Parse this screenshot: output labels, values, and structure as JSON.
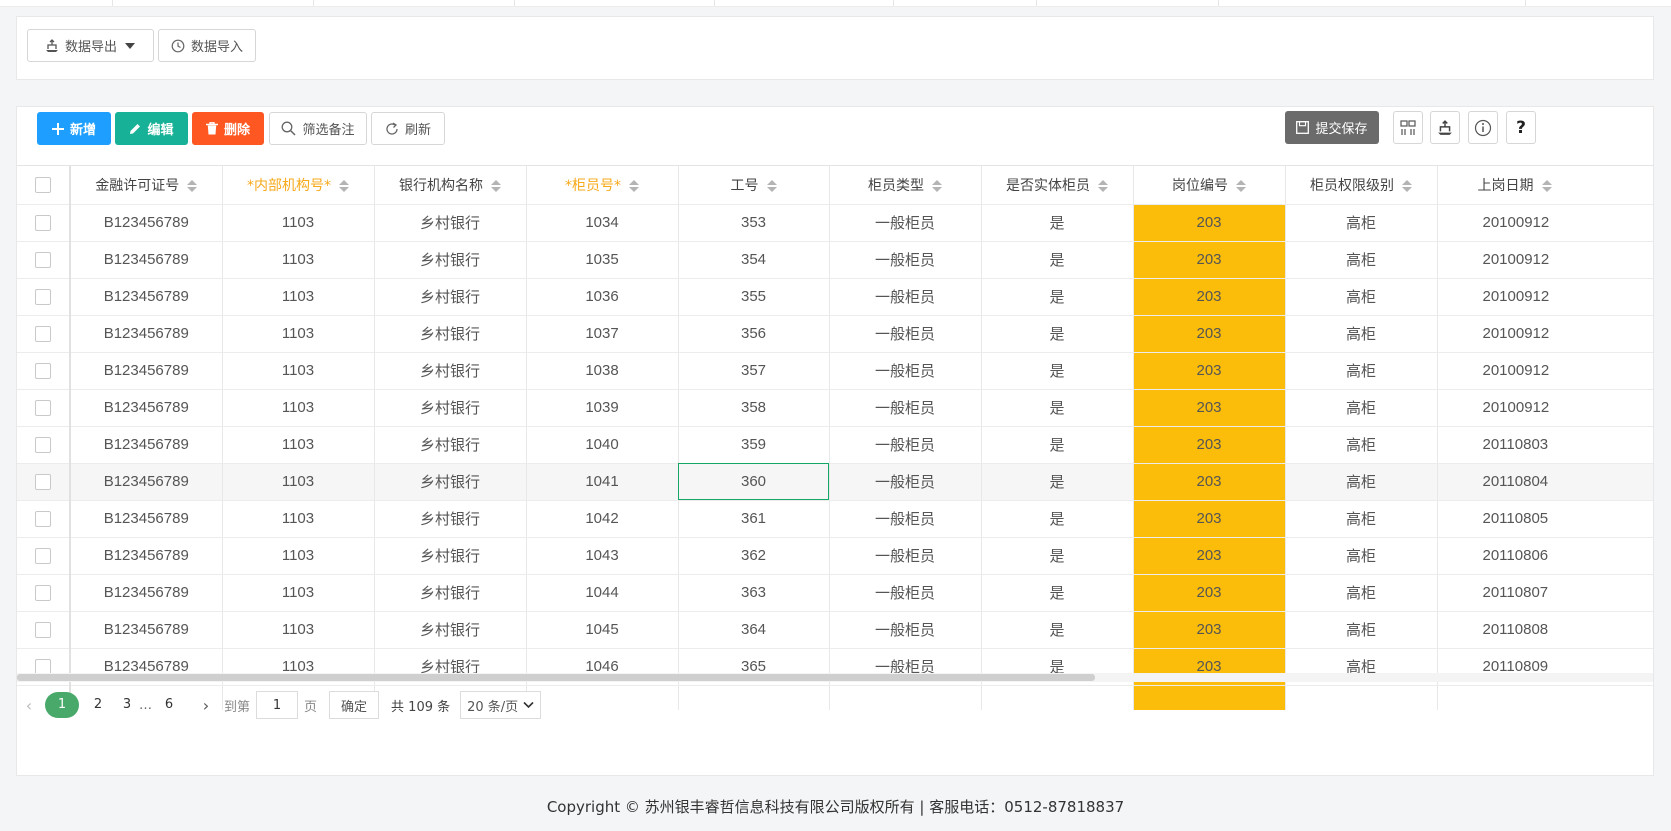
{
  "export_panel": {
    "export_label": "数据导出",
    "import_label": "数据导入"
  },
  "toolbar": {
    "add_label": "新增",
    "edit_label": "编辑",
    "delete_label": "删除",
    "filter_label": "筛选备注",
    "refresh_label": "刷新",
    "submit_label": "提交保存",
    "help_label": "?"
  },
  "table": {
    "columns": [
      {
        "label": "金融许可证号",
        "required": false
      },
      {
        "label": "*内部机构号*",
        "required": true
      },
      {
        "label": "银行机构名称",
        "required": false
      },
      {
        "label": "*柜员号*",
        "required": true
      },
      {
        "label": "工号",
        "required": false
      },
      {
        "label": "柜员类型",
        "required": false
      },
      {
        "label": "是否实体柜员",
        "required": false
      },
      {
        "label": "岗位编号",
        "required": false
      },
      {
        "label": "柜员权限级别",
        "required": false
      },
      {
        "label": "上岗日期",
        "required": false
      }
    ],
    "rows": [
      [
        "B123456789",
        "1103",
        "乡村银行",
        "1034",
        "353",
        "一般柜员",
        "是",
        "203",
        "高柜",
        "20100912"
      ],
      [
        "B123456789",
        "1103",
        "乡村银行",
        "1035",
        "354",
        "一般柜员",
        "是",
        "203",
        "高柜",
        "20100912"
      ],
      [
        "B123456789",
        "1103",
        "乡村银行",
        "1036",
        "355",
        "一般柜员",
        "是",
        "203",
        "高柜",
        "20100912"
      ],
      [
        "B123456789",
        "1103",
        "乡村银行",
        "1037",
        "356",
        "一般柜员",
        "是",
        "203",
        "高柜",
        "20100912"
      ],
      [
        "B123456789",
        "1103",
        "乡村银行",
        "1038",
        "357",
        "一般柜员",
        "是",
        "203",
        "高柜",
        "20100912"
      ],
      [
        "B123456789",
        "1103",
        "乡村银行",
        "1039",
        "358",
        "一般柜员",
        "是",
        "203",
        "高柜",
        "20100912"
      ],
      [
        "B123456789",
        "1103",
        "乡村银行",
        "1040",
        "359",
        "一般柜员",
        "是",
        "203",
        "高柜",
        "20110803"
      ],
      [
        "B123456789",
        "1103",
        "乡村银行",
        "1041",
        "360",
        "一般柜员",
        "是",
        "203",
        "高柜",
        "20110804"
      ],
      [
        "B123456789",
        "1103",
        "乡村银行",
        "1042",
        "361",
        "一般柜员",
        "是",
        "203",
        "高柜",
        "20110805"
      ],
      [
        "B123456789",
        "1103",
        "乡村银行",
        "1043",
        "362",
        "一般柜员",
        "是",
        "203",
        "高柜",
        "20110806"
      ],
      [
        "B123456789",
        "1103",
        "乡村银行",
        "1044",
        "363",
        "一般柜员",
        "是",
        "203",
        "高柜",
        "20110807"
      ],
      [
        "B123456789",
        "1103",
        "乡村银行",
        "1045",
        "364",
        "一般柜员",
        "是",
        "203",
        "高柜",
        "20110808"
      ],
      [
        "B123456789",
        "1103",
        "乡村银行",
        "1046",
        "365",
        "一般柜员",
        "是",
        "203",
        "高柜",
        "20110809"
      ]
    ],
    "highlight_color": "#fbbd0a",
    "required_header_color": "#f7a91b"
  },
  "pagination": {
    "pages": [
      "1",
      "2",
      "3"
    ],
    "ellipsis": "…",
    "last_page": "6",
    "goto_label": "到第",
    "goto_value": "1",
    "page_unit": "页",
    "confirm_label": "确定",
    "total_label": "共 109 条",
    "page_size_label": "20 条/页"
  },
  "footer": {
    "copyright": "Copyright © 苏州银丰睿哲信息科技有限公司版权所有 | 客服电话：0512-87818837"
  }
}
